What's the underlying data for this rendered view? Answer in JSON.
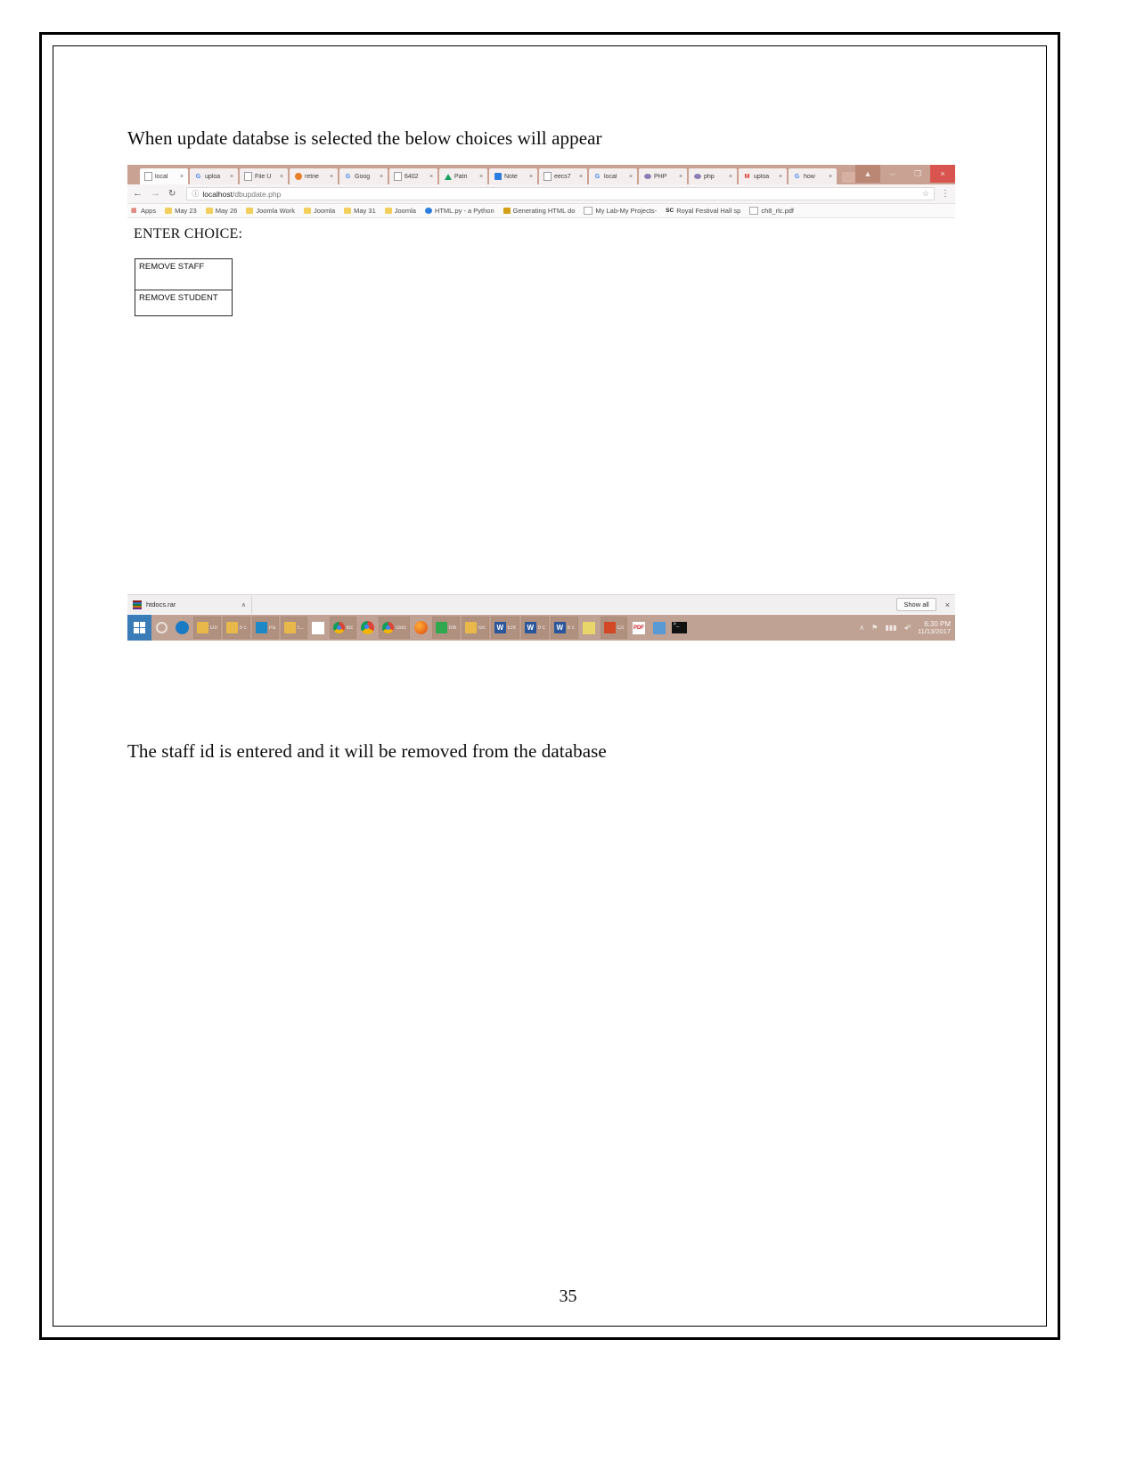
{
  "document": {
    "caption_top": "When update databse is selected the below choices will appear",
    "caption_bottom": "The staff id is entered and it will be removed from the database",
    "page_number": "35"
  },
  "browser": {
    "tabs": [
      {
        "title": "local",
        "favicon": "page-icon",
        "close": "×",
        "active": true
      },
      {
        "title": "uploa",
        "favicon": "google-icon",
        "close": "×",
        "active": false
      },
      {
        "title": "File U",
        "favicon": "page-icon",
        "close": "×",
        "active": false
      },
      {
        "title": "retrie",
        "favicon": "firefox-icon",
        "close": "×",
        "active": false
      },
      {
        "title": "Goog",
        "favicon": "google-icon",
        "close": "×",
        "active": false
      },
      {
        "title": "6402",
        "favicon": "page-icon",
        "close": "×",
        "active": false
      },
      {
        "title": "Patri",
        "favicon": "drive-icon",
        "close": "×",
        "active": false
      },
      {
        "title": "Note",
        "favicon": "blue-page-icon",
        "close": "×",
        "active": false
      },
      {
        "title": "eecs7",
        "favicon": "page-icon",
        "close": "×",
        "active": false
      },
      {
        "title": "local",
        "favicon": "google-icon",
        "close": "×",
        "active": false
      },
      {
        "title": "PHP",
        "favicon": "php-icon",
        "close": "×",
        "active": false
      },
      {
        "title": "php",
        "favicon": "php-icon",
        "close": "×",
        "active": false
      },
      {
        "title": "uploa",
        "favicon": "gmail-icon",
        "close": "×",
        "active": false
      },
      {
        "title": "how",
        "favicon": "google-icon",
        "close": "×",
        "active": false
      }
    ],
    "window_controls": {
      "user": "▲",
      "minimize": "–",
      "maximize": "❐",
      "close": "×"
    },
    "toolbar": {
      "back": "←",
      "forward": "→",
      "reload": "↻",
      "info": "ⓘ",
      "url_host": "localhost",
      "url_path": "/dbupdate.php",
      "star": "☆",
      "menu": "⋮"
    },
    "bookmarks": [
      {
        "label": "Apps",
        "icon": "apps-grid-icon"
      },
      {
        "label": "May 23",
        "icon": "folder-icon"
      },
      {
        "label": "May 26",
        "icon": "folder-icon"
      },
      {
        "label": "Joomla Work",
        "icon": "folder-icon"
      },
      {
        "label": "Joomla",
        "icon": "folder-icon"
      },
      {
        "label": "May 31",
        "icon": "folder-icon"
      },
      {
        "label": "Joomla",
        "icon": "folder-icon"
      },
      {
        "label": "HTML.py - a Python",
        "icon": "html-icon"
      },
      {
        "label": "Generating HTML do",
        "icon": "pen-icon"
      },
      {
        "label": "My Lab-My Projects-",
        "icon": "page-icon"
      },
      {
        "label": "Royal Festival Hall sp",
        "icon": "sc-icon"
      },
      {
        "label": "ch8_rlc.pdf",
        "icon": "page-icon"
      }
    ],
    "page": {
      "heading": "ENTER CHOICE:",
      "buttons": [
        {
          "label": "REMOVE STAFF"
        },
        {
          "label": "REMOVE STUDENT"
        }
      ]
    },
    "download_shelf": {
      "file_name": "htdocs.rar",
      "caret": "∧",
      "show_all": "Show all",
      "close": "×"
    }
  },
  "taskbar": {
    "start": "windows-logo",
    "items": [
      {
        "icon": "search-icon",
        "label": ""
      },
      {
        "icon": "ie-icon",
        "label": ""
      },
      {
        "icon": "folder-icon",
        "label": "Do"
      },
      {
        "icon": "folder-icon",
        "label": "9 c"
      },
      {
        "icon": "paint-icon",
        "label": "Pa"
      },
      {
        "icon": "folder-icon",
        "label": "I..."
      },
      {
        "icon": "chart-icon",
        "label": ""
      },
      {
        "icon": "chrome-icon",
        "label": "loc"
      },
      {
        "icon": "chrome-icon",
        "label": ""
      },
      {
        "icon": "chrome-icon",
        "label": "Goo"
      },
      {
        "icon": "firefox-icon",
        "label": ""
      },
      {
        "icon": "mail-icon",
        "label": "Inb"
      },
      {
        "icon": "folder-icon",
        "label": "loc"
      },
      {
        "icon": "word-icon",
        "label": "Ent"
      },
      {
        "icon": "word-icon",
        "label": "9 c"
      },
      {
        "icon": "word-icon",
        "label": "6 c"
      },
      {
        "icon": "chart-icon",
        "label": ""
      },
      {
        "icon": "ppt-icon",
        "label": "Co"
      },
      {
        "icon": "pdf-icon",
        "label": ""
      },
      {
        "icon": "chart-icon",
        "label": ""
      },
      {
        "icon": "cmd-icon",
        "label": ""
      }
    ],
    "tray": {
      "chevron": "∧",
      "flag": "⚑",
      "network": "▮▮▮",
      "volume": "◂ᴴ",
      "time": "6:30 PM",
      "date": "11/13/2017"
    }
  }
}
